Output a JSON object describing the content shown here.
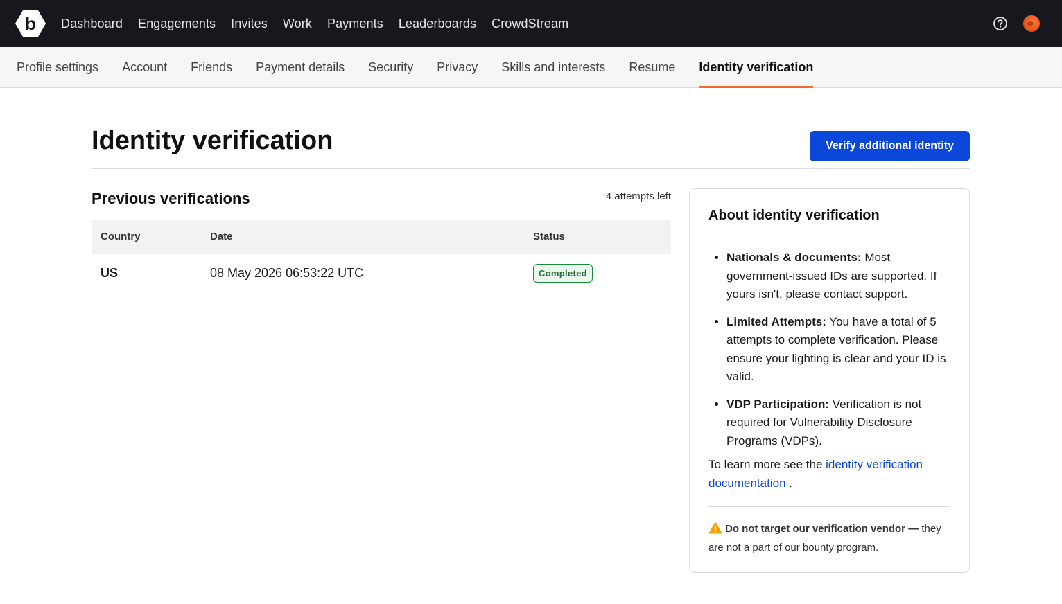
{
  "topnav": {
    "items": [
      "Dashboard",
      "Engagements",
      "Invites",
      "Work",
      "Payments",
      "Leaderboards",
      "CrowdStream"
    ]
  },
  "tabs": {
    "items": [
      "Profile settings",
      "Account",
      "Friends",
      "Payment details",
      "Security",
      "Privacy",
      "Skills and interests",
      "Resume",
      "Identity verification"
    ],
    "active": "Identity verification"
  },
  "page": {
    "title": "Identity verification",
    "verify_button": "Verify additional identity"
  },
  "verifications": {
    "title": "Previous verifications",
    "attempts_left": "4 attempts left",
    "columns": [
      "Country",
      "Date",
      "Status"
    ],
    "rows": [
      {
        "country": "US",
        "date": "08 May 2026 06:53:22 UTC",
        "status": "Completed"
      }
    ]
  },
  "about": {
    "title": "About identity verification",
    "bullets": [
      {
        "label": "Nationals & documents:",
        "text": " Most government-issued IDs are supported. If yours isn't, please contact support."
      },
      {
        "label": "Limited Attempts:",
        "text": " You have a total of 5 attempts to complete verification. Please ensure your lighting is clear and your ID is valid."
      },
      {
        "label": "VDP Participation:",
        "text": " Verification is not required for Vulnerability Disclosure Programs (VDPs)."
      }
    ],
    "learn_prefix": "To learn more see the ",
    "learn_link": "identity verification documentation",
    "learn_suffix": " .",
    "warning_bold": "Do not target our verification vendor —",
    "warning_text": " they are not a part of our bounty program."
  },
  "colors": {
    "topbar": "#16181d",
    "accent": "#ef6e2a",
    "primary": "#0b47d9",
    "success": "#1c8a3e"
  }
}
